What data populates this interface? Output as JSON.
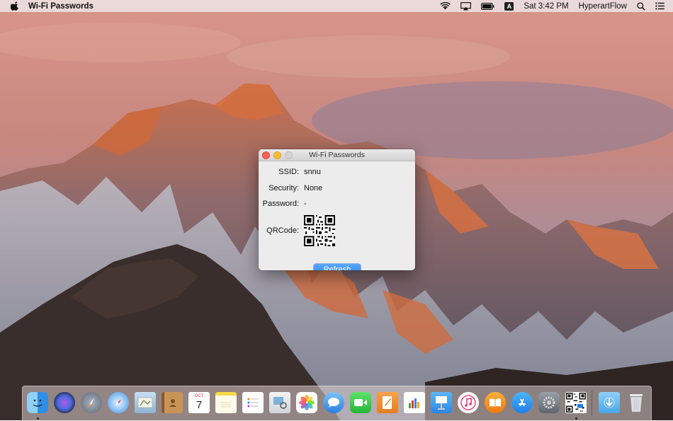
{
  "menubar": {
    "app_name": "Wi-Fi Passwords",
    "input_source": "A",
    "clock": "Sat 3:42 PM",
    "user": "HyperartFlow"
  },
  "window": {
    "title": "Wi-Fi Passwords",
    "ssid_label": "SSID:",
    "ssid_value": "snnu",
    "security_label": "Security:",
    "security_value": "None",
    "password_label": "Password:",
    "password_value": "-",
    "qrcode_label": "QRCode:",
    "refresh_label": "Refresh"
  },
  "dock": {
    "items": [
      {
        "name": "finder-icon",
        "running": true
      },
      {
        "name": "siri-icon"
      },
      {
        "name": "launchpad-icon"
      },
      {
        "name": "safari-icon"
      },
      {
        "name": "mail-icon"
      },
      {
        "name": "contacts-icon"
      },
      {
        "name": "calendar-icon",
        "month": "OCT",
        "day": "7"
      },
      {
        "name": "notes-icon"
      },
      {
        "name": "reminders-icon"
      },
      {
        "name": "preview-icon"
      },
      {
        "name": "photos-icon"
      },
      {
        "name": "messages-icon"
      },
      {
        "name": "facetime-icon"
      },
      {
        "name": "pages-icon"
      },
      {
        "name": "numbers-icon"
      },
      {
        "name": "keynote-icon"
      },
      {
        "name": "itunes-icon"
      },
      {
        "name": "ibooks-icon"
      },
      {
        "name": "app-store-icon"
      },
      {
        "name": "system-preferences-icon"
      },
      {
        "name": "wifi-passwords-app-icon",
        "running": true
      },
      {
        "name": "downloads-folder-icon"
      },
      {
        "name": "trash-icon"
      }
    ]
  }
}
